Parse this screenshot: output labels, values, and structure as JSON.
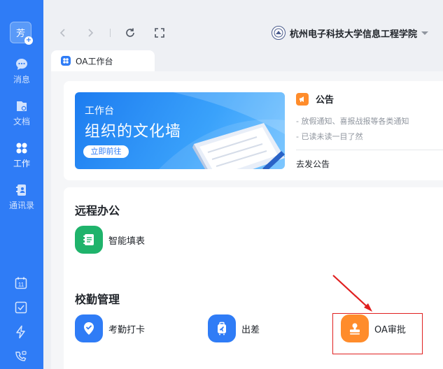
{
  "sidebar": {
    "avatar_text": "芳",
    "items": [
      {
        "label": "消息",
        "icon": "chat-icon"
      },
      {
        "label": "文档",
        "icon": "document-icon"
      },
      {
        "label": "工作",
        "icon": "workbench-icon"
      },
      {
        "label": "通讯录",
        "icon": "contacts-icon"
      }
    ],
    "bottom_icons": [
      "calendar-icon",
      "todo-check-icon",
      "lightning-icon",
      "video-call-icon"
    ],
    "calendar_day": "11",
    "accent": "#2f7cf6"
  },
  "topbar": {
    "org_name": "杭州电子科技大学信息工程学院"
  },
  "tab": {
    "label": "OA工作台"
  },
  "banner": {
    "small_title": "工作台",
    "big_title": "组织的文化墙",
    "button_label": "立即前往"
  },
  "notice": {
    "title": "公告",
    "lines": [
      "- 放假通知、喜报战报等各类通知",
      "- 已读未读一目了然"
    ],
    "post_label": "去发公告"
  },
  "sections": {
    "remote": {
      "title": "远程办公",
      "apps": [
        {
          "label": "智能填表",
          "icon": "form-icon",
          "color": "#1fb36b"
        }
      ]
    },
    "attendance": {
      "title": "校勤管理",
      "apps": [
        {
          "label": "考勤打卡",
          "icon": "location-check-icon",
          "color": "#2f7cf6"
        },
        {
          "label": "出差",
          "icon": "luggage-icon",
          "color": "#2f7cf6"
        },
        {
          "label": "OA审批",
          "icon": "stamp-icon",
          "color": "#ff8c2b"
        }
      ]
    }
  },
  "annotation_color": "#e02020"
}
